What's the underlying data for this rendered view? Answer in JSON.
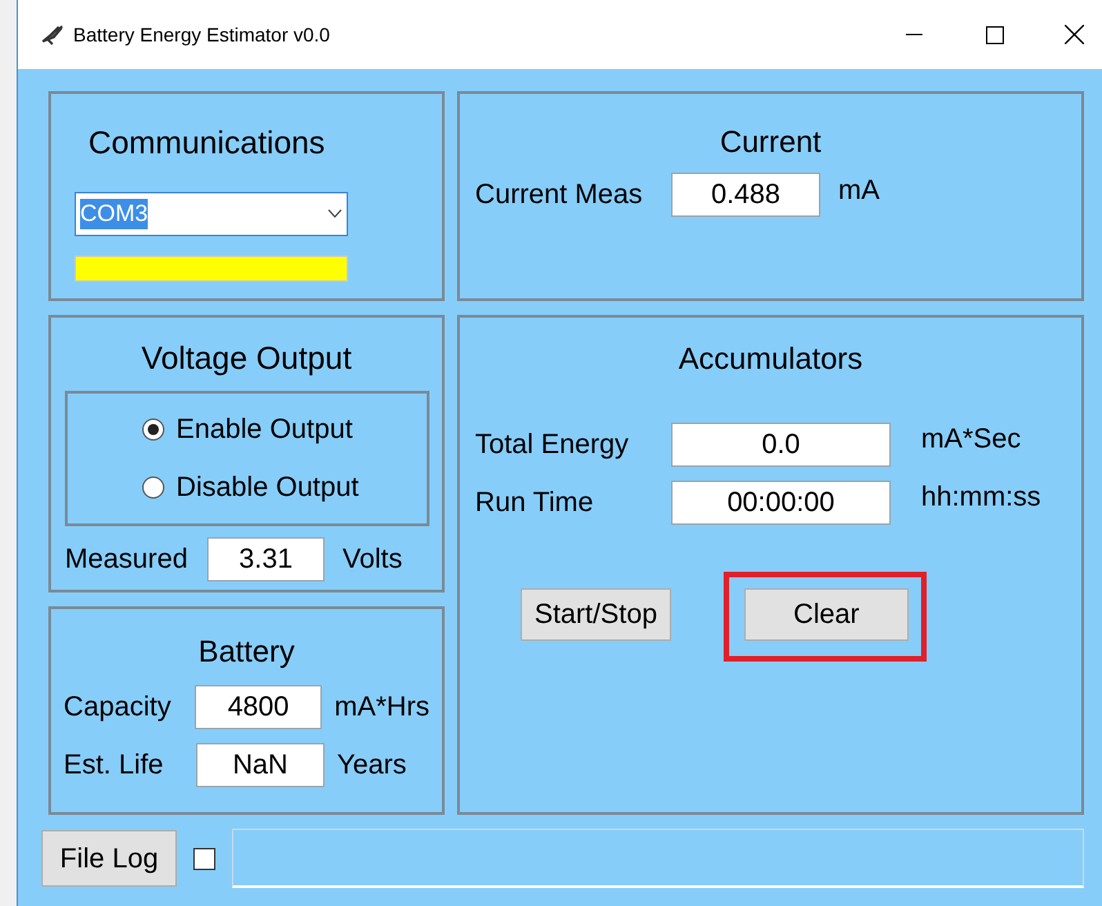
{
  "window": {
    "title": "Battery Energy Estimator v0.0"
  },
  "communications": {
    "title": "Communications",
    "port": "COM3"
  },
  "current": {
    "title": "Current",
    "label": "Current Meas",
    "value": "0.488",
    "unit": "mA"
  },
  "voltage_output": {
    "title": "Voltage Output",
    "options": [
      {
        "label": "Enable Output",
        "selected": true
      },
      {
        "label": "Disable Output",
        "selected": false
      }
    ],
    "measured_label": "Measured",
    "measured_value": "3.31",
    "measured_unit": "Volts"
  },
  "accumulators": {
    "title": "Accumulators",
    "rows": [
      {
        "label": "Total Energy",
        "value": "0.0",
        "unit": "mA*Sec"
      },
      {
        "label": "Run Time",
        "value": "00:00:00",
        "unit": "hh:mm:ss"
      }
    ],
    "buttons": [
      {
        "label": "Start/Stop",
        "highlighted": false
      },
      {
        "label": "Clear",
        "highlighted": true
      }
    ]
  },
  "battery": {
    "title": "Battery",
    "rows": [
      {
        "label": "Capacity",
        "value": "4800",
        "unit": "mA*Hrs"
      },
      {
        "label": "Est. Life",
        "value": "NaN",
        "unit": "Years"
      }
    ]
  },
  "footer": {
    "button": "File Log",
    "checked": false
  }
}
